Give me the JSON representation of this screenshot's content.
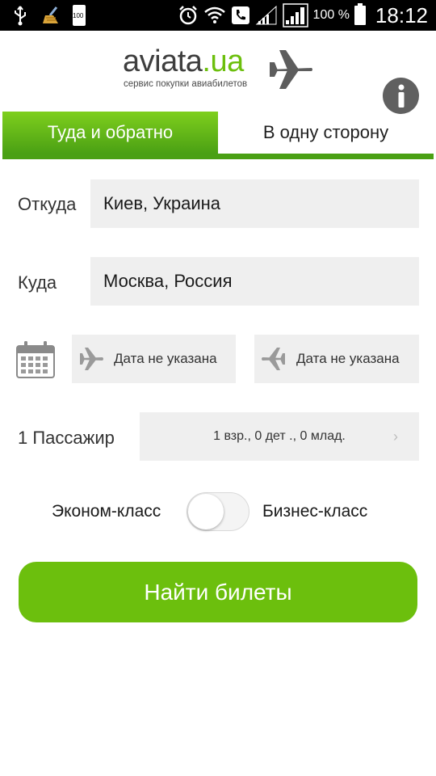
{
  "status_bar": {
    "battery_icon_label": "100",
    "battery_percent": "100 %",
    "time": "18:12",
    "icons": [
      "usb-icon",
      "cleaner-icon",
      "battery-small-icon",
      "alarm-icon",
      "wifi-icon",
      "phone-icon",
      "signal-icon",
      "signal-icon",
      "battery-icon"
    ]
  },
  "header": {
    "logo_main": "aviata",
    "logo_tld": ".ua",
    "logo_subtitle": "сервис покупки авиабилетов",
    "info_icon": "info-icon"
  },
  "tabs": [
    {
      "label": "Туда и обратно",
      "active": true
    },
    {
      "label": "В одну сторону",
      "active": false
    }
  ],
  "form": {
    "from_label": "Откуда",
    "from_value": "Киев, Украина",
    "to_label": "Куда",
    "to_value": "Москва, Россия",
    "date_depart": "Дата не указана",
    "date_return": "Дата не указана",
    "passengers_label": "1 Пассажир",
    "passengers_value": "1 взр., 0 дет ., 0 млад.",
    "class_economy": "Эконом-класс",
    "class_business": "Бизнес-класс",
    "business_class_selected": false,
    "search_button": "Найти билеты"
  },
  "colors": {
    "accent": "#6cbf0d",
    "accent_dark": "#4aa014",
    "field_bg": "#efefef",
    "status_bar": "#000000"
  }
}
